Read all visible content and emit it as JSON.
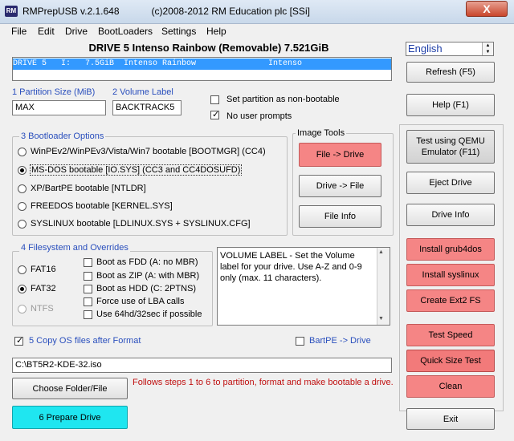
{
  "window": {
    "title": "RMPrepUSB v.2.1.648            (c)2008-2012 RM Education plc [SSi]",
    "icon_text": "RM",
    "close_symbol": "X"
  },
  "menu": [
    "File",
    "Edit",
    "Drive",
    "BootLoaders",
    "Settings",
    "Help"
  ],
  "drive_header": "DRIVE 5 Intenso Rainbow  (Removable) 7.521GiB",
  "language": {
    "selected": "English"
  },
  "drive_list": {
    "row": "DRIVE 5   I:   7.5GiB  Intenso Rainbow               Intenso"
  },
  "buttons": {
    "refresh": "Refresh (F5)",
    "help": "Help (F1)",
    "test_qemu": "Test using QEMU Emulator (F11)",
    "eject": "Eject Drive",
    "drive_info": "Drive Info",
    "install_grub4dos": "Install grub4dos",
    "install_syslinux": "Install syslinux",
    "create_ext2": "Create Ext2 FS",
    "test_speed": "Test Speed",
    "quick_size": "Quick Size Test",
    "clean": "Clean",
    "file_to_drive": "File -> Drive",
    "drive_to_file": "Drive -> File",
    "file_info": "File Info",
    "choose_folder": "Choose Folder/File",
    "prepare_drive": "6 Prepare Drive",
    "exit": "Exit"
  },
  "partition": {
    "label": "1 Partition Size (MiB)",
    "value": "MAX"
  },
  "volume": {
    "label": "2 Volume Label",
    "value": "BACKTRACK5"
  },
  "options": {
    "non_bootable": "Set partition as non-bootable",
    "no_prompts": "No user prompts"
  },
  "image_tools": {
    "title": "Image Tools"
  },
  "bootloader": {
    "title": "3 Bootloader Options",
    "items": [
      "WinPEv2/WinPEv3/Vista/Win7 bootable [BOOTMGR] (CC4)",
      "MS-DOS bootable [IO.SYS]    (CC3 and CC4DOSUFD)",
      "XP/BartPE bootable [NTLDR]",
      "FREEDOS bootable [KERNEL.SYS]",
      "SYSLINUX bootable [LDLINUX.SYS + SYSLINUX.CFG]"
    ]
  },
  "filesystem": {
    "title": "4 Filesystem and Overrides",
    "radios": [
      "FAT16",
      "FAT32",
      "NTFS"
    ],
    "overrides": [
      "Boot as FDD (A: no MBR)",
      "Boot as ZIP (A: with MBR)",
      "Boot as HDD (C: 2PTNS)",
      "Force use of LBA calls",
      "Use 64hd/32sec if possible"
    ]
  },
  "memo": "VOLUME LABEL - Set the Volume label for your drive. Use A-Z and 0-9 only (max. 11 characters).",
  "copy_os": {
    "label": "5 Copy OS files after Format"
  },
  "bartpe": {
    "label": "BartPE -> Drive"
  },
  "path": {
    "value": "C:\\BT5R2-KDE-32.iso"
  },
  "hint": "Follows steps 1 to 6 to partition, format and make bootable a drive."
}
